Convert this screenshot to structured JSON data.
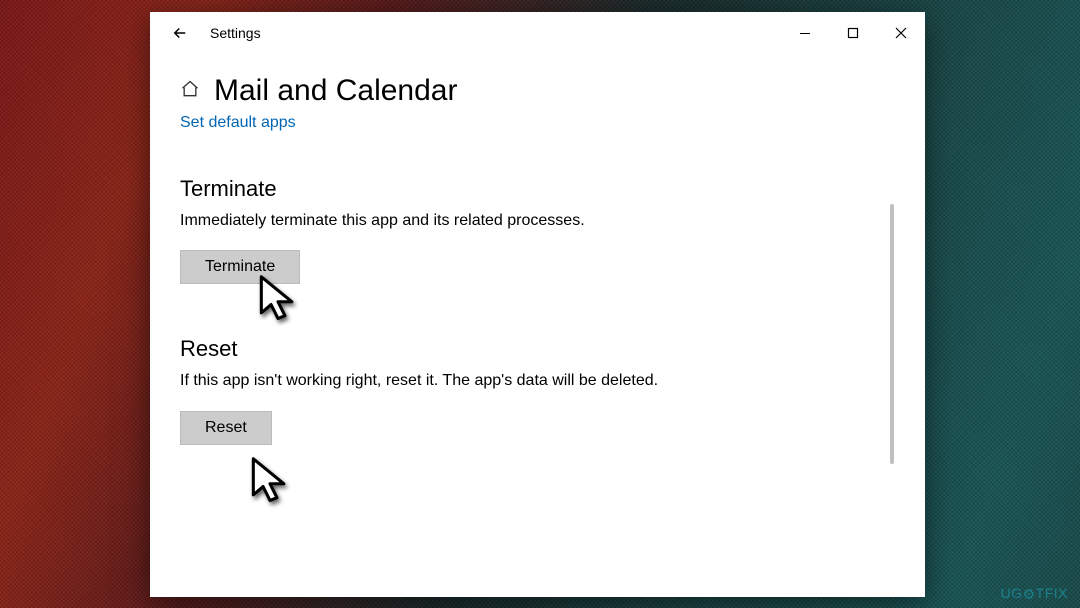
{
  "titlebar": {
    "title": "Settings"
  },
  "page": {
    "title": "Mail and Calendar",
    "default_apps_link": "Set default apps"
  },
  "terminate": {
    "heading": "Terminate",
    "description": "Immediately terminate this app and its related processes.",
    "button_label": "Terminate"
  },
  "reset": {
    "heading": "Reset",
    "description": "If this app isn't working right, reset it. The app's data will be deleted.",
    "button_label": "Reset"
  },
  "watermark": "UG TFIX"
}
